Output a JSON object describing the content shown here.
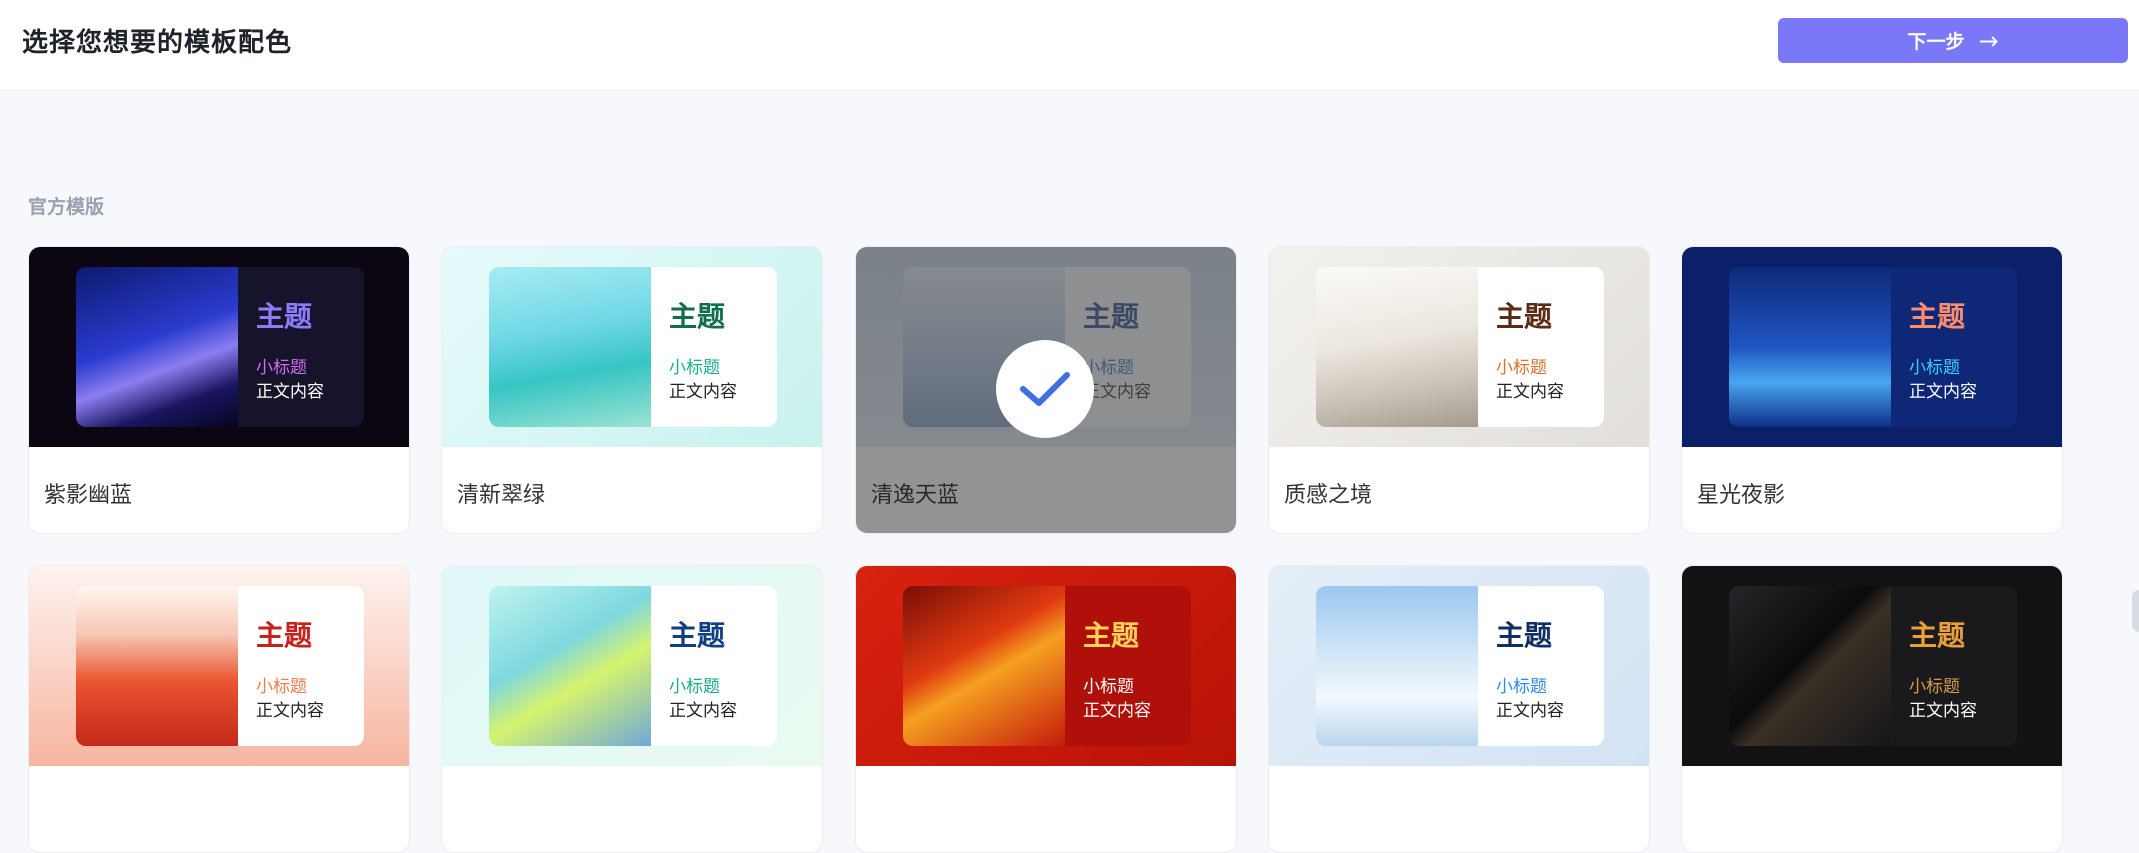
{
  "header": {
    "title": "选择您想要的模板配色",
    "next_label": "下一步",
    "next_arrow": "→"
  },
  "section": {
    "label": "官方模版"
  },
  "preview_text": {
    "title": "主题",
    "subtitle": "小标题",
    "body": "正文内容"
  },
  "cards": [
    {
      "name": "紫影幽蓝",
      "selected": false,
      "thumb_bg": "#0c0612",
      "art": "linear-gradient(160deg,#0d1a6e 0%,#2a3bcf 45%,#8c7df0 62%,#1a1560 80%,#050520 100%)",
      "panel_bg": "#15142a",
      "title_color": "#8e7cff",
      "sub_color": "#d06af0",
      "body_color": "#ffffff"
    },
    {
      "name": "清新翠绿",
      "selected": false,
      "thumb_bg": "linear-gradient(135deg,#e6fbfb,#c8f2ee)",
      "art": "linear-gradient(170deg,#a7ecf2 0%,#6fd7e6 40%,#37c5c4 65%,#9be3d2 100%)",
      "panel_bg": "#ffffff",
      "title_color": "#0f6e4c",
      "sub_color": "#16b286",
      "body_color": "#222222"
    },
    {
      "name": "清逸天蓝",
      "selected": true,
      "thumb_bg": "linear-gradient(180deg,#bfd0e6,#dbe7f4)",
      "art": "linear-gradient(180deg,#dfe9f5 0%,#aac2de 55%,#7b98c2 100%)",
      "panel_bg": "#eef3fa",
      "title_color": "#1f3a8a",
      "sub_color": "#3763c8",
      "body_color": "#222222"
    },
    {
      "name": "质感之境",
      "selected": false,
      "thumb_bg": "linear-gradient(135deg,#f3f1ee,#e2dfda)",
      "art": "linear-gradient(170deg,#fbfaf8 0%,#ece7df 45%,#c9c1b6 75%,#a59b8f 100%)",
      "panel_bg": "#ffffff",
      "title_color": "#5b2a12",
      "sub_color": "#e0702a",
      "body_color": "#222222"
    },
    {
      "name": "星光夜影",
      "selected": false,
      "thumb_bg": "#0b2068",
      "art": "linear-gradient(180deg,#0d2a7a 0%,#1f55c2 50%,#49a6ef 72%,#0d2f86 100%)",
      "panel_bg": "#0e2877",
      "title_color": "#ff8c6a",
      "sub_color": "#38d0ff",
      "body_color": "#ffffff"
    },
    {
      "name": "",
      "selected": false,
      "thumb_bg": "linear-gradient(180deg,#fdf3ef,#f7b59f)",
      "art": "linear-gradient(180deg,#fff6f2 0%,#f7c7b3 30%,#e8542e 60%,#c5281a 100%)",
      "panel_bg": "#ffffff",
      "title_color": "#c8201a",
      "sub_color": "#f07a4a",
      "body_color": "#222222"
    },
    {
      "name": "",
      "selected": false,
      "thumb_bg": "linear-gradient(135deg,#dff8f8,#e9fbf0)",
      "art": "linear-gradient(150deg,#bff3f0 0%,#7ed8df 40%,#d6f36e 60%,#6fa9d8 100%)",
      "panel_bg": "#ffffff",
      "title_color": "#0f3f86",
      "sub_color": "#19a88a",
      "body_color": "#222222"
    },
    {
      "name": "",
      "selected": false,
      "thumb_bg": "linear-gradient(135deg,#d8220e,#b81208)",
      "art": "linear-gradient(150deg,#7a0d06 0%,#e03a10 40%,#f5a020 55%,#c51a0c 100%)",
      "panel_bg": "#b0100a",
      "title_color": "#ffd25a",
      "sub_color": "#ffffff",
      "body_color": "#ffffff"
    },
    {
      "name": "",
      "selected": false,
      "thumb_bg": "linear-gradient(135deg,#e4eef8,#d2e3f3)",
      "art": "linear-gradient(180deg,#9cc7ef 0%,#d4e8f8 45%,#f3f8fd 70%,#b7d5ef 100%)",
      "panel_bg": "#ffffff",
      "title_color": "#0f2f63",
      "sub_color": "#2f8be0",
      "body_color": "#222222"
    },
    {
      "name": "",
      "selected": false,
      "thumb_bg": "#121214",
      "art": "linear-gradient(135deg,#26262a 0%,#0b0b0d 45%,#3a3024 55%,#16161a 100%)",
      "panel_bg": "#1a1a1c",
      "title_color": "#e9a03a",
      "sub_color": "#d89a4a",
      "body_color": "#ffffff"
    }
  ]
}
